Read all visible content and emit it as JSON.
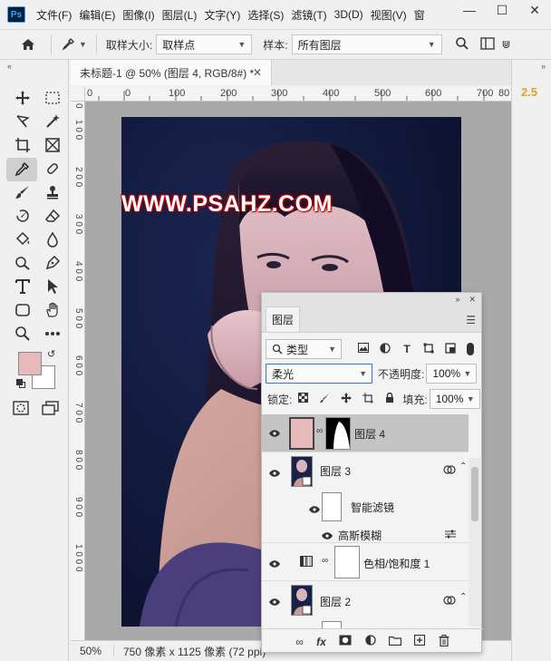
{
  "app": {
    "logo": "Ps",
    "menu": [
      "文件(F)",
      "编辑(E)",
      "图像(I)",
      "图层(L)",
      "文字(Y)",
      "选择(S)",
      "滤镜(T)",
      "3D(D)",
      "视图(V)",
      "窗"
    ]
  },
  "options_bar": {
    "sample_size_label": "取样大小:",
    "sample_size_value": "取样点",
    "sample_label": "样本:",
    "sample_value": "所有图层"
  },
  "document": {
    "tab_title": "未标题-1 @ 50% (图层 4, RGB/8#) *",
    "ruler_h": [
      "0",
      "0",
      "100",
      "200",
      "300",
      "400",
      "500",
      "600",
      "700",
      "80"
    ],
    "ruler_v": [
      "0",
      "1 0 0",
      "2 0 0",
      "3 0 0",
      "4 0 0",
      "5 0 0",
      "6 0 0",
      "7 0 0",
      "8 0 0",
      "9 0 0",
      "1 0 0 0"
    ],
    "watermark": "WWW.PSAHZ.COM"
  },
  "status": {
    "zoom": "50%",
    "info": "750 像素 x 1125 像素 (72 ppi)"
  },
  "right_dock": {
    "value": "2.5"
  },
  "layers_panel": {
    "tab": "图层",
    "filter_kind": "类型",
    "blend_mode": "柔光",
    "opacity_label": "不透明度:",
    "opacity_value": "100%",
    "lock_label": "锁定:",
    "fill_label": "填充:",
    "fill_value": "100%",
    "layers": [
      {
        "name": "图层 4"
      },
      {
        "name": "图层 3"
      },
      {
        "name": "智能滤镜"
      },
      {
        "name": "高斯模糊"
      },
      {
        "name": "色相/饱和度 1"
      },
      {
        "name": "图层 2"
      }
    ]
  },
  "colors": {
    "foreground": "#e8b9bb",
    "background": "#ffffff",
    "accent": "#e8a020"
  }
}
